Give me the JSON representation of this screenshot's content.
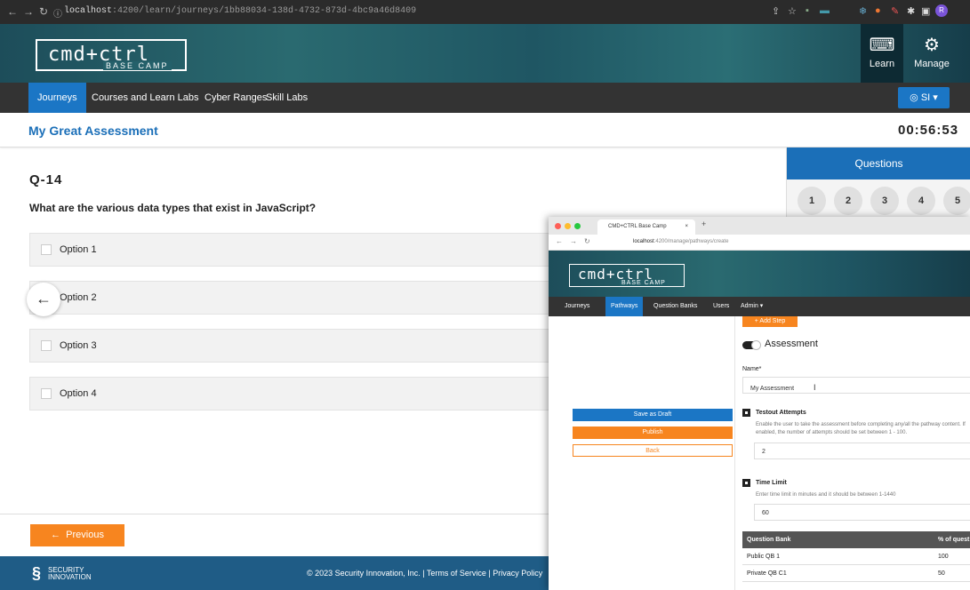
{
  "browser": {
    "url_host": "localhost",
    "url_rest": ":4200/learn/journeys/1bb88034-138d-4732-873d-4bc9a46d8409",
    "profile_letter": "R"
  },
  "brand": {
    "logo_text": "cmd+ctrl",
    "logo_sub": "BASE CAMP"
  },
  "header": {
    "learn_label": "Learn",
    "manage_label": "Manage"
  },
  "nav": {
    "items": [
      "Journeys",
      "Courses and Learn Labs",
      "Cyber Ranges",
      "Skill Labs"
    ],
    "user_label": "SI"
  },
  "assessment": {
    "title": "My Great Assessment",
    "timer": "00:56:53"
  },
  "question": {
    "id": "Q-14",
    "text": "What are the various data types that exist in JavaScript?",
    "options": [
      "Option 1",
      "Option 2",
      "Option 3",
      "Option 4"
    ]
  },
  "panel": {
    "title": "Questions",
    "numbers": [
      "1",
      "2",
      "3",
      "4",
      "5"
    ]
  },
  "footer": {
    "previous_label": "Previous",
    "logo_line1": "SECURITY",
    "logo_line2": "INNOVATION",
    "copyright": "© 2023 Security Innovation, Inc. | Terms of Service | Privacy Policy"
  },
  "overlay": {
    "tab_title": "CMD+CTRL Base Camp",
    "url_host": "localhost",
    "url_rest": ":4200/manage/pathways/create",
    "nav": [
      "Journeys",
      "Pathways",
      "Question Banks",
      "Users",
      "Admin ▾"
    ],
    "add_step": "+ Add Step",
    "section_title": "Assessment",
    "name_label": "Name*",
    "name_value": "My Assessment",
    "testout_title": "Testout Attempts",
    "testout_hint": "Enable the user to take the assessment before completing any/all the pathway content. If enabled, the number of attempts should be set between 1 - 100.",
    "testout_value": "2",
    "time_title": "Time Limit",
    "time_hint": "Enter time limit in minutes and it should be between 1-1440",
    "time_value": "60",
    "save_draft": "Save as Draft",
    "publish": "Publish",
    "back": "Back",
    "table": {
      "headers": [
        "Question Bank",
        "% of quest"
      ],
      "rows": [
        [
          "Public QB 1",
          "100"
        ],
        [
          "Private QB C1",
          "50"
        ]
      ]
    }
  },
  "colors": {
    "brand_blue": "#1b6fb8",
    "accent_orange": "#f7851f",
    "nav_dark": "#333333"
  }
}
